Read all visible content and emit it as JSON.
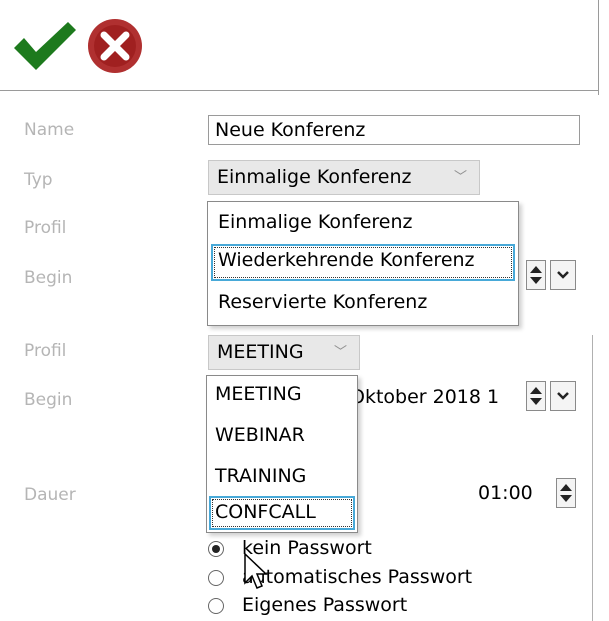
{
  "toolbar": {
    "confirm_icon": "checkmark-icon",
    "cancel_icon": "cancel-icon",
    "confirm_color": "#1d7a1d",
    "cancel_color": "#b03030"
  },
  "form": {
    "name_label": "Name",
    "name_value": "Neue Konferenz",
    "type_label": "Typ",
    "type_value": "Einmalige Konferenz",
    "profile_label": "Profil",
    "begin_label": "Begin",
    "profile_label_2": "Profil",
    "begin_label_2": "Begin",
    "duration_label": "Dauer"
  },
  "type_dropdown": {
    "options": [
      "Einmalige Konferenz",
      "Wiederkehrende Konferenz",
      "Reservierte Konferenz"
    ],
    "focused_index": 1
  },
  "profile_combo": {
    "value": "MEETING",
    "options": [
      "MEETING",
      "WEBINAR",
      "TRAINING",
      "CONFCALL"
    ],
    "focused_index": 3
  },
  "begin_value_visible": "Oktober 2018 1",
  "duration_value": "01:00",
  "password_options": [
    {
      "label": "kein Passwort",
      "selected": true
    },
    {
      "label": "automatisches Passwort",
      "selected": false
    },
    {
      "label": "Eigenes Passwort",
      "selected": false
    }
  ]
}
